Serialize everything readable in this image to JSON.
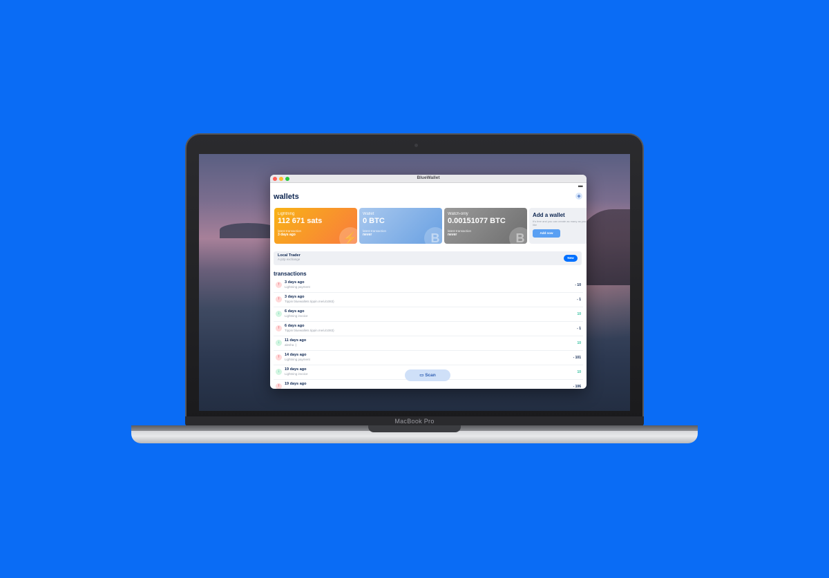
{
  "device": {
    "label": "MacBook Pro"
  },
  "window": {
    "title": "BlueWallet"
  },
  "header": {
    "title": "wallets",
    "more_icon": "more-icon",
    "add_icon": "add-icon"
  },
  "wallets": [
    {
      "type_label": "Lightning",
      "balance": "112 671 sats",
      "latest_label": "latest transaction",
      "latest_value": "3 days ago",
      "watermark": "lightning-icon"
    },
    {
      "type_label": "Wallet",
      "balance": "0 BTC",
      "latest_label": "latest transaction",
      "latest_value": "never",
      "watermark": "bitcoin-icon"
    },
    {
      "type_label": "Watch-only",
      "balance": "0.00151077 BTC",
      "latest_label": "latest transaction",
      "latest_value": "never",
      "watermark": "bitcoin-icon"
    }
  ],
  "add_wallet": {
    "title": "Add a wallet",
    "description": "It's free and you can create as many as you like",
    "button": "Add now"
  },
  "local_trader": {
    "title": "Local Trader",
    "subtitle": "A p2p exchange",
    "button": "New"
  },
  "transactions": {
    "title": "transactions",
    "items": [
      {
        "direction": "out",
        "date": "3 days ago",
        "memo": "Lightning payment",
        "amount": "- 10"
      },
      {
        "direction": "out",
        "date": "3 days ago",
        "memo": "Tippin bluewallets tippin.me/u/1083)",
        "amount": "- 1"
      },
      {
        "direction": "in",
        "date": "6 days ago",
        "memo": "Lightning invoice",
        "amount": "10"
      },
      {
        "direction": "out",
        "date": "6 days ago",
        "memo": "Tippin bluewallets tippin.me/u/1083)",
        "amount": "- 1"
      },
      {
        "direction": "in",
        "date": "11 days ago",
        "memo": "alesha :)",
        "amount": "10"
      },
      {
        "direction": "out",
        "date": "14 days ago",
        "memo": "Lightning payment",
        "amount": "- 101"
      },
      {
        "direction": "in",
        "date": "19 days ago",
        "memo": "Lightning invoice",
        "amount": "10"
      },
      {
        "direction": "out",
        "date": "19 days ago",
        "memo": "",
        "amount": "- 106"
      }
    ]
  },
  "scan_button": {
    "label": "Scan",
    "icon": "scan-icon"
  },
  "colors": {
    "background": "#0a6cf5",
    "accent": "#0070ff",
    "positive": "#37c0a1",
    "negative": "#d0021b",
    "heading": "#0c2550"
  }
}
